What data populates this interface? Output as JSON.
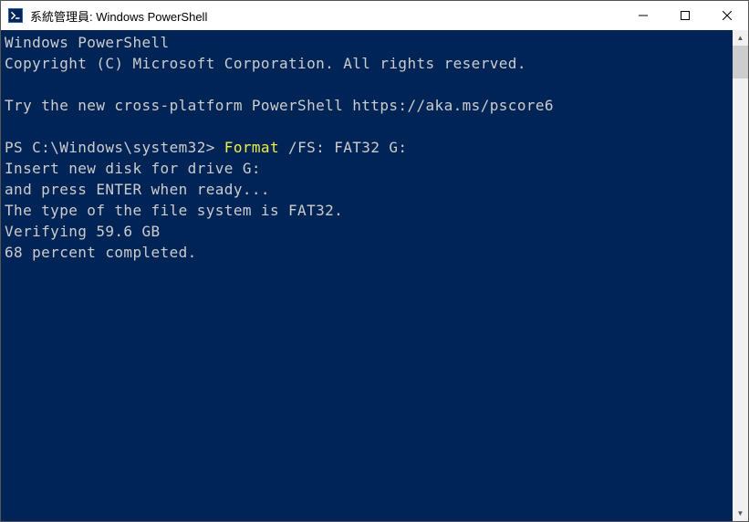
{
  "window": {
    "title": "系統管理員: Windows PowerShell",
    "icon_label": "PowerShell"
  },
  "terminal": {
    "lines": [
      "Windows PowerShell",
      "Copyright (C) Microsoft Corporation. All rights reserved.",
      "",
      "Try the new cross-platform PowerShell https://aka.ms/pscore6",
      "",
      "",
      "Insert new disk for drive G:",
      "and press ENTER when ready...",
      "The type of the file system is FAT32.",
      "Verifying 59.6 GB",
      "68 percent completed."
    ],
    "prompt": "PS C:\\Windows\\system32> ",
    "command_highlight": "Format",
    "command_rest": " /FS: FAT32 G:"
  },
  "colors": {
    "terminal_bg": "#012456",
    "terminal_fg": "#cccccc",
    "highlight": "#eeee44"
  }
}
